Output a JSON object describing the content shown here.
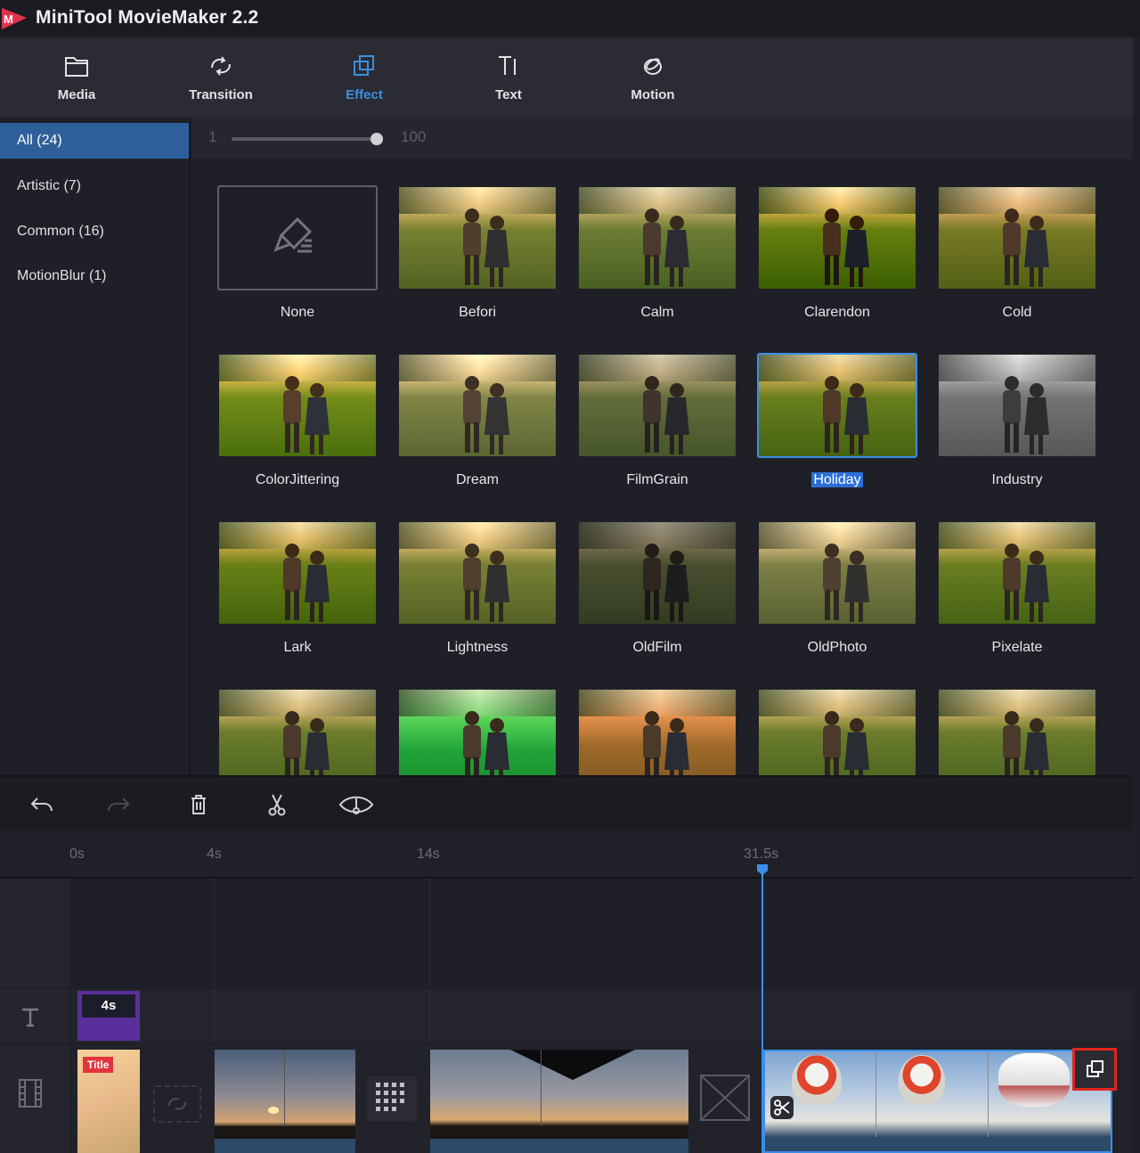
{
  "app": {
    "title": "MiniTool MovieMaker 2.2",
    "logo_icon": "minitool-logo"
  },
  "toolbar": {
    "items": [
      {
        "label": "Media",
        "icon": "folder-icon"
      },
      {
        "label": "Transition",
        "icon": "transition-icon"
      },
      {
        "label": "Effect",
        "icon": "effect-icon",
        "active": true
      },
      {
        "label": "Text",
        "icon": "text-icon"
      },
      {
        "label": "Motion",
        "icon": "motion-icon"
      }
    ],
    "accent_color": "#3d8fe0"
  },
  "sidebar": {
    "categories": [
      {
        "label": "All",
        "count": "(24)",
        "active": true
      },
      {
        "label": "Artistic",
        "count": "(7)"
      },
      {
        "label": "Common",
        "count": "(16)"
      },
      {
        "label": "MotionBlur",
        "count": "(1)"
      }
    ]
  },
  "slider": {
    "min_label": "1",
    "max_label": "100",
    "value_fraction": 1.0
  },
  "effects": [
    {
      "name": "None"
    },
    {
      "name": "Befori"
    },
    {
      "name": "Calm"
    },
    {
      "name": "Clarendon"
    },
    {
      "name": "Cold"
    },
    {
      "name": "ColorJittering"
    },
    {
      "name": "Dream"
    },
    {
      "name": "FilmGrain"
    },
    {
      "name": "Holiday",
      "selected": true
    },
    {
      "name": "Industry"
    },
    {
      "name": "Lark"
    },
    {
      "name": "Lightness"
    },
    {
      "name": "OldFilm"
    },
    {
      "name": "OldPhoto"
    },
    {
      "name": "Pixelate"
    },
    {
      "name": ""
    },
    {
      "name": ""
    },
    {
      "name": ""
    },
    {
      "name": ""
    },
    {
      "name": ""
    }
  ],
  "timeline": {
    "tools": [
      "undo-icon",
      "redo-icon",
      "delete-icon",
      "split-icon",
      "zoom-fit-icon"
    ],
    "ruler_ticks": [
      "0s",
      "4s",
      "14s",
      "31.5s"
    ],
    "title_clip": {
      "duration": "4s",
      "label": "Title"
    }
  }
}
